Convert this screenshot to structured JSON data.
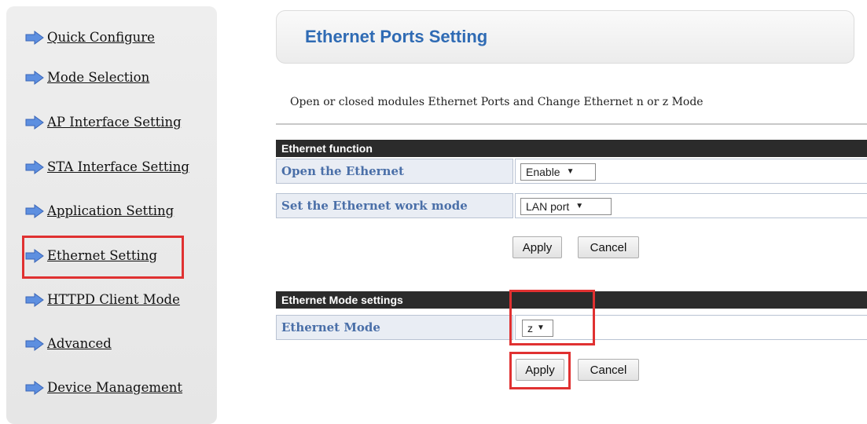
{
  "sidebar": {
    "items": [
      {
        "label": "Quick Configure"
      },
      {
        "label": "Mode Selection"
      },
      {
        "label": "AP Interface Setting"
      },
      {
        "label": "STA Interface Setting"
      },
      {
        "label": "Application Setting"
      },
      {
        "label": "Ethernet Setting"
      },
      {
        "label": "HTTPD Client Mode"
      },
      {
        "label": "Advanced"
      },
      {
        "label": "Device Management"
      }
    ]
  },
  "page": {
    "title": "Ethernet Ports Setting",
    "description": "Open or closed modules Ethernet Ports and Change Ethernet n or z Mode"
  },
  "ethernet_function": {
    "header": "Ethernet function",
    "open_label": "Open the Ethernet",
    "open_value": "Enable",
    "work_mode_label": "Set the Ethernet work mode",
    "work_mode_value": "LAN port",
    "apply_label": "Apply",
    "cancel_label": "Cancel"
  },
  "ethernet_mode": {
    "header": "Ethernet Mode settings",
    "mode_label": "Ethernet Mode",
    "mode_value": "z",
    "apply_label": "Apply",
    "cancel_label": "Cancel"
  },
  "colors": {
    "title_blue": "#2f6bb4",
    "label_blue": "#4a6fa8",
    "highlight_red": "#e03131",
    "header_dark": "#2b2b2b"
  }
}
